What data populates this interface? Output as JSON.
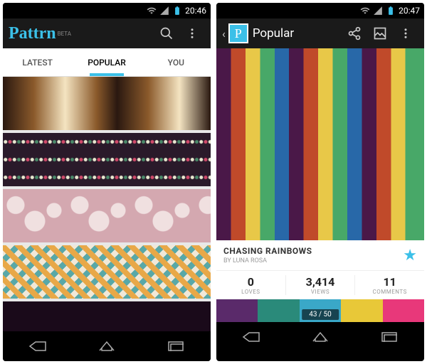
{
  "left": {
    "status": {
      "time": "20:46"
    },
    "app": {
      "logo": "Pattrn",
      "badge": "BETA"
    },
    "tabs": [
      {
        "label": "LATEST",
        "active": false
      },
      {
        "label": "POPULAR",
        "active": true
      },
      {
        "label": "YOU",
        "active": false
      }
    ]
  },
  "right": {
    "status": {
      "time": "20:47"
    },
    "header": {
      "title": "Popular",
      "app_glyph": "P"
    },
    "detail": {
      "title": "CHASING RAINBOWS",
      "author": "BY LUNA ROSA",
      "stats": [
        {
          "value": "0",
          "label": "LOVES"
        },
        {
          "value": "3,414",
          "label": "VIEWS"
        },
        {
          "value": "11",
          "label": "COMMENTS"
        }
      ],
      "palette": [
        "#5a2a6a",
        "#2a8a7a",
        "#3aa8c8",
        "#e8c838",
        "#e8387a"
      ],
      "counter": "43 / 50"
    }
  }
}
